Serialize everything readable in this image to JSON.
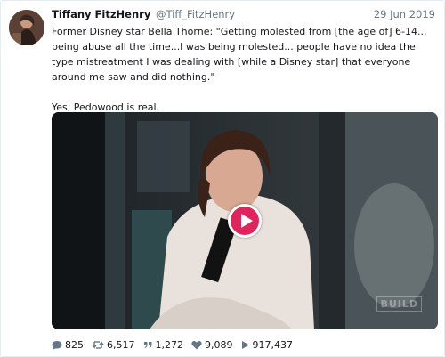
{
  "tweet": {
    "author_name": "Tiffany FitzHenry",
    "handle": "@Tiff_FitzHenry",
    "date": "29 Jun 2019",
    "paragraph1": "Former Disney star Bella Thorne: \"Getting molested from [the age of] 6-14... being abuse all the time...I was being molested....people have no idea the type mistreatment I was dealing with [while a Disney star] that everyone around me saw and did nothing.\"",
    "paragraph2": "Yes, Pedowood is real."
  },
  "media": {
    "watermark": "BUILD",
    "play_button_color": "#e0245e"
  },
  "stats": {
    "replies": "825",
    "retweets": "6,517",
    "quotes": "1,272",
    "likes": "9,089",
    "views": "917,437"
  },
  "icons": [
    "reply-icon",
    "retweet-icon",
    "quote-icon",
    "heart-icon",
    "play-count-icon"
  ]
}
